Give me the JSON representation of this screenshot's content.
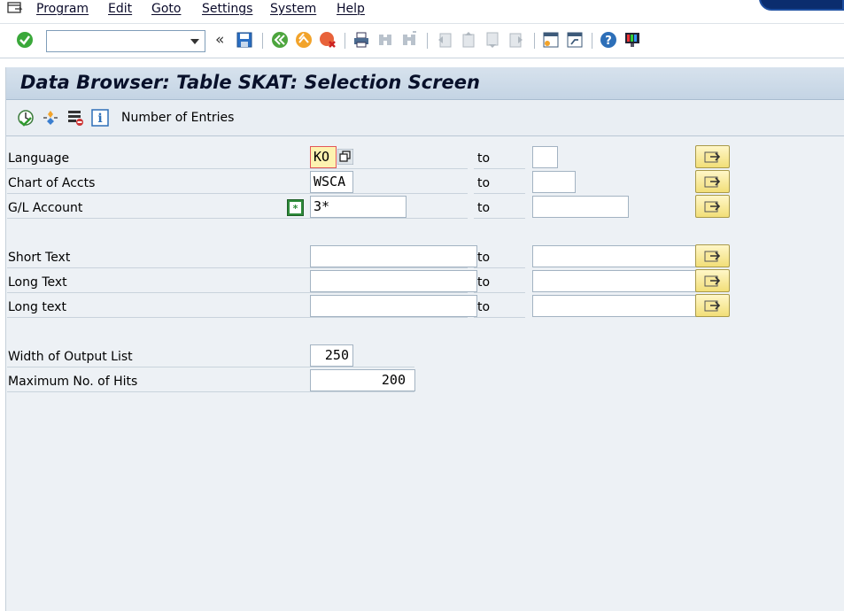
{
  "menu": {
    "items": [
      "Program",
      "Edit",
      "Goto",
      "Settings",
      "System",
      "Help"
    ]
  },
  "toolbar": {
    "command_value": ""
  },
  "screen": {
    "title": "Data Browser: Table SKAT: Selection Screen",
    "app_toolbar_label": "Number of Entries"
  },
  "selection": {
    "to_label": "to",
    "rows": [
      {
        "label": "Language",
        "from": "KO",
        "to": ""
      },
      {
        "label": "Chart of Accts",
        "from": "WSCA",
        "to": ""
      },
      {
        "label": "G/L Account",
        "from": "3*",
        "to": ""
      },
      {
        "label": "Short Text",
        "from": "",
        "to": ""
      },
      {
        "label": "Long Text",
        "from": "",
        "to": ""
      },
      {
        "label": "Long text",
        "from": "",
        "to": ""
      }
    ]
  },
  "output": {
    "width_label": "Width of Output List",
    "width_value": "250",
    "max_hits_label": "Maximum No. of Hits",
    "max_hits_value": "200"
  },
  "colors": {
    "accent_title_bg": "#c4d4e4",
    "content_bg": "#edf1f5",
    "multi_btn": "#f2df78"
  }
}
